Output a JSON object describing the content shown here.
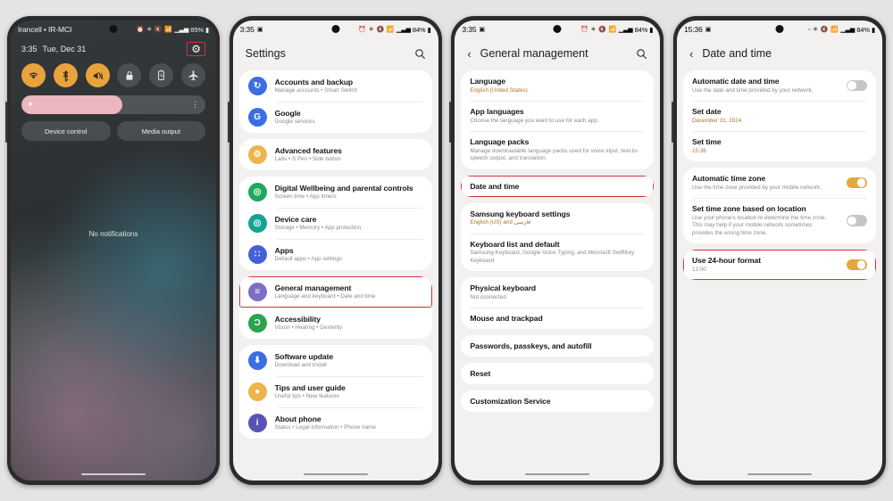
{
  "canvas": {
    "background": "#e4e4e4"
  },
  "accent": {
    "amber": "#e5a83c",
    "highlight": "#d2323c",
    "subtitle_accent": "#a9762c"
  },
  "phone1": {
    "status": {
      "carrier": "Irancell • IR-MCI",
      "icons": "⏰ ✳ 🔇 📶",
      "battery": "85%"
    },
    "time": "3:35",
    "date": "Tue, Dec 31",
    "gear_icon": "⚙",
    "tiles": [
      {
        "name": "wifi",
        "glyph": "◔",
        "state": "on"
      },
      {
        "name": "bluetooth",
        "glyph": "ᛗ",
        "state": "on"
      },
      {
        "name": "sound-mute",
        "glyph": "🔇",
        "state": "on"
      },
      {
        "name": "screen-lock",
        "glyph": "🔒",
        "state": "off"
      },
      {
        "name": "power-saving",
        "glyph": "🔋",
        "state": "off"
      },
      {
        "name": "airplane-mode",
        "glyph": "✈",
        "state": "off"
      }
    ],
    "brightness": {
      "sun_icon": "☀",
      "fill_percent": 55,
      "more_icon": "⋮"
    },
    "buttons": {
      "device_control": "Device control",
      "media_output": "Media output"
    },
    "no_notifications": "No notifications"
  },
  "phone2": {
    "status": {
      "time": "3:35",
      "battery": "84%"
    },
    "header": {
      "title": "Settings",
      "search_icon": "search-icon"
    },
    "groups": [
      {
        "items": [
          {
            "title": "Accounts and backup",
            "sub": "Manage accounts  •  Smart Switch",
            "icon": "sync-icon",
            "color": "#3b6fe0",
            "glyph": "↻"
          },
          {
            "title": "Google",
            "sub": "Google services",
            "icon": "google-icon",
            "color": "#3b6fe0",
            "glyph": "G"
          }
        ]
      },
      {
        "items": [
          {
            "title": "Advanced features",
            "sub": "Labs  •  S Pen  •  Side button",
            "icon": "gear-icon",
            "color": "#efb44a",
            "glyph": "⚙"
          }
        ]
      },
      {
        "items": [
          {
            "title": "Digital Wellbeing and parental controls",
            "sub": "Screen time  •  App timers",
            "icon": "wellbeing-icon",
            "color": "#1fa85b",
            "glyph": "◎"
          },
          {
            "title": "Device care",
            "sub": "Storage  •  Memory  •  App protection",
            "icon": "device-care-icon",
            "color": "#13a394",
            "glyph": "◎"
          },
          {
            "title": "Apps",
            "sub": "Default apps  •  App settings",
            "icon": "apps-grid-icon",
            "color": "#4360d8",
            "glyph": "∷"
          }
        ]
      },
      {
        "items": [
          {
            "title": "General management",
            "sub": "Language and keyboard  •  Date and time",
            "icon": "sliders-icon",
            "color": "#7a6fc4",
            "glyph": "≡",
            "highlight": true
          },
          {
            "title": "Accessibility",
            "sub": "Vision  •  Hearing  •  Dexterity",
            "icon": "accessibility-icon",
            "color": "#2aa44f",
            "glyph": "Ɔ"
          }
        ]
      },
      {
        "items": [
          {
            "title": "Software update",
            "sub": "Download and install",
            "icon": "software-update-icon",
            "color": "#3b6fe0",
            "glyph": "⬇"
          },
          {
            "title": "Tips and user guide",
            "sub": "Useful tips  •  New features",
            "icon": "lightbulb-icon",
            "color": "#efb44a",
            "glyph": "●"
          },
          {
            "title": "About phone",
            "sub": "Status  •  Legal information  •  Phone name",
            "icon": "info-icon",
            "color": "#5b52b5",
            "glyph": "i"
          }
        ]
      }
    ]
  },
  "phone3": {
    "status": {
      "time": "3:35",
      "battery": "84%"
    },
    "header": {
      "title": "General management",
      "back_icon": "back-chevron-icon",
      "search_icon": "search-icon"
    },
    "groups": [
      {
        "items": [
          {
            "title": "Language",
            "sub": "English (United States)",
            "sub_accent": true
          },
          {
            "title": "App languages",
            "sub": "Choose the language you want to use for each app."
          },
          {
            "title": "Language packs",
            "sub": "Manage downloadable language packs used for voice input, text-to-speech output, and translation."
          }
        ]
      },
      {
        "items": [
          {
            "title": "Date and time",
            "sub": "",
            "highlight": true
          }
        ]
      },
      {
        "items": [
          {
            "title": "Samsung keyboard settings",
            "sub": "English (US) and فارسی",
            "sub_accent": true
          },
          {
            "title": "Keyboard list and default",
            "sub": "Samsung Keyboard, Google Voice Typing, and Microsoft SwiftKey Keyboard"
          }
        ]
      },
      {
        "items": [
          {
            "title": "Physical keyboard",
            "sub": "Not connected"
          },
          {
            "title": "Mouse and trackpad",
            "sub": ""
          }
        ]
      },
      {
        "items": [
          {
            "title": "Passwords, passkeys, and autofill",
            "sub": ""
          }
        ]
      },
      {
        "items": [
          {
            "title": "Reset",
            "sub": ""
          }
        ]
      },
      {
        "items": [
          {
            "title": "Customization Service",
            "sub": ""
          }
        ]
      }
    ]
  },
  "phone4": {
    "status": {
      "time": "15:36",
      "battery": "84%"
    },
    "header": {
      "title": "Date and time",
      "back_icon": "back-chevron-icon"
    },
    "groups": [
      {
        "items": [
          {
            "title": "Automatic date and time",
            "sub": "Use the date and time provided by your network.",
            "toggle": "off"
          },
          {
            "title": "Set date",
            "sub": "December 31, 2024",
            "sub_accent": true
          },
          {
            "title": "Set time",
            "sub": "15:36",
            "sub_accent": true
          }
        ]
      },
      {
        "items": [
          {
            "title": "Automatic time zone",
            "sub": "Use the time zone provided by your mobile network.",
            "toggle": "on"
          },
          {
            "title": "Set time zone based on location",
            "sub": "Use your phone's location to determine the time zone. This may help if your mobile network sometimes provides the wrong time zone.",
            "toggle": "off"
          }
        ]
      },
      {
        "items": [
          {
            "title": "Use 24-hour format",
            "sub": "13:00",
            "toggle": "on",
            "highlight": true
          }
        ]
      }
    ]
  }
}
